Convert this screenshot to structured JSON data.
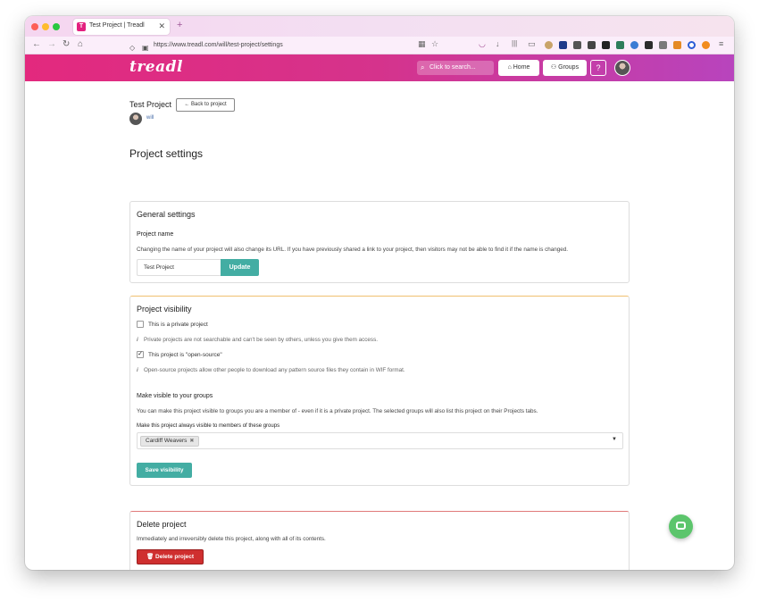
{
  "browser": {
    "tab_title": "Test Project | Treadl",
    "url": "https://www.treadl.com/will/test-project/settings",
    "new_tab": "+",
    "close": "✕"
  },
  "header": {
    "logo": "treadl",
    "search_placeholder": "Click to search...",
    "home_label": "Home",
    "groups_label": "Groups",
    "help_label": "?"
  },
  "project": {
    "title": "Test Project",
    "back_label": "Back to project",
    "owner": "will"
  },
  "page_heading": "Project settings",
  "general": {
    "title": "General settings",
    "name_label": "Project name",
    "name_help": "Changing the name of your project will also change its URL. If you have previously shared a link to your project, then visitors may not be able to find it if the name is changed.",
    "name_value": "Test Project",
    "update_label": "Update"
  },
  "visibility": {
    "title": "Project visibility",
    "private_label": "This is a private project",
    "private_checked": false,
    "private_info": "Private projects are not searchable and can't be seen by others, unless you give them access.",
    "open_source_label": "This project is \"open-source\"",
    "open_source_checked": true,
    "open_source_info": "Open-source projects allow other people to download any pattern source files they contain in WIF format.",
    "groups_title": "Make visible to your groups",
    "groups_help": "You can make this project visible to groups you are a member of - even if it is a private project. The selected groups will also list this project on their Projects tabs.",
    "groups_field_label": "Make this project always visible to members of these groups",
    "selected_group": "Cardiff Weavers",
    "save_label": "Save visibility"
  },
  "delete": {
    "title": "Delete project",
    "help": "Immediately and irreversibly delete this project, along with all of its contents.",
    "button_label": "Delete project"
  },
  "colors": {
    "accent_teal": "#43ada3",
    "danger_red": "#cf2f2f",
    "brand_pink": "#e3297e"
  }
}
